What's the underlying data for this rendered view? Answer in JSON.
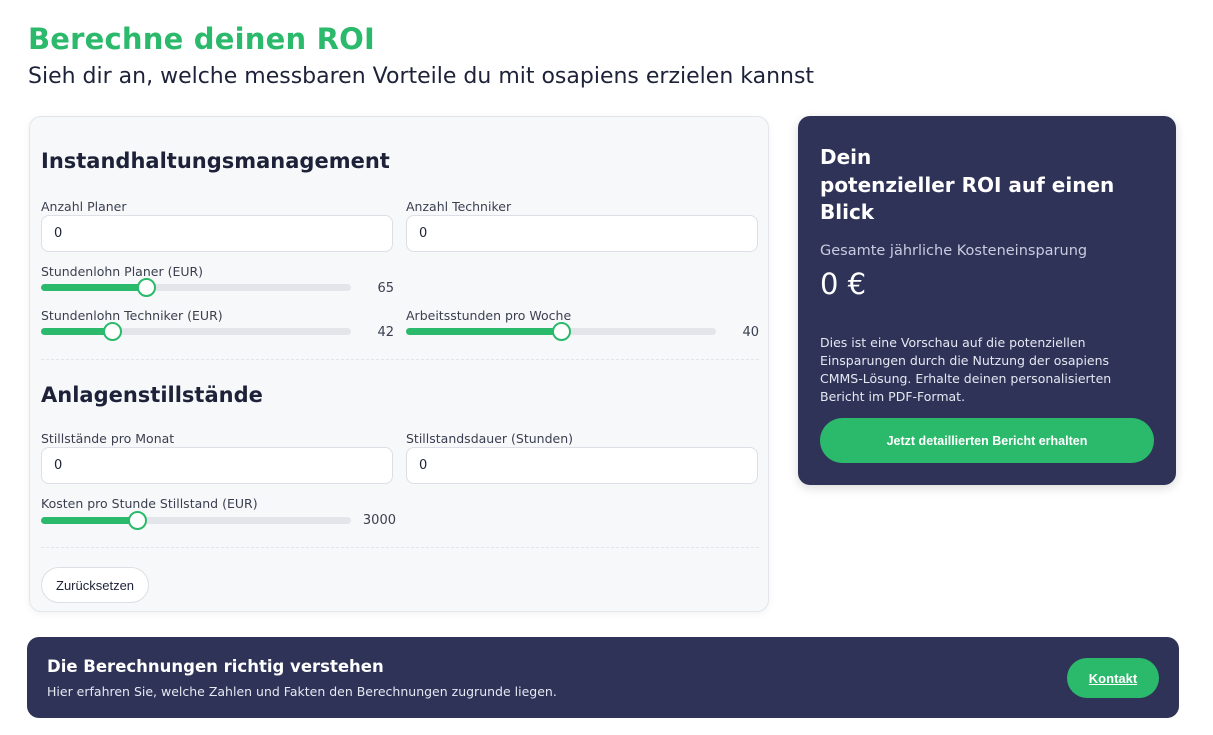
{
  "header": {
    "title": "Berechne deinen ROI",
    "subtitle": "Sieh dir an, welche messbaren Vorteile du mit osapiens erzielen kannst"
  },
  "form": {
    "maintenance": {
      "title": "Instandhaltungsmanagement",
      "planners": {
        "label": "Anzahl Planer",
        "value": "0"
      },
      "technicians": {
        "label": "Anzahl Techniker",
        "value": "0"
      },
      "planner_rate": {
        "label": "Stundenlohn Planer (EUR)",
        "value": "65",
        "fraction": 0.34
      },
      "technician_rate": {
        "label": "Stundenlohn Techniker (EUR)",
        "value": "42",
        "fraction": 0.23
      },
      "hours_per_week": {
        "label": "Arbeitsstunden pro Woche",
        "value": "40",
        "fraction": 0.5
      }
    },
    "downtime": {
      "title": "Anlagenstillstände",
      "per_month": {
        "label": "Stillstände pro Monat",
        "value": "0"
      },
      "duration": {
        "label": "Stillstandsdauer (Stunden)",
        "value": "0"
      },
      "cost_per_hour": {
        "label": "Kosten pro Stunde Stillstand (EUR)",
        "value": "3000",
        "fraction": 0.31
      }
    },
    "reset_label": "Zurücksetzen"
  },
  "roi": {
    "title": "Dein\npotenzieller ROI auf einen Blick",
    "savings_label": "Gesamte jährliche Kosteneinsparung",
    "savings_value": "0 €",
    "description": "Dies ist eine Vorschau auf die potenziellen Einsparungen durch die Nutzung der osapiens CMMS-Lösung. Erhalte deinen personalisierten Bericht im PDF-Format.",
    "cta_label": "Jetzt detaillierten Bericht erhalten"
  },
  "banner": {
    "title": "Die Berechnungen richtig verstehen",
    "subtitle": "Hier erfahren Sie, welche Zahlen und Fakten den Berechnungen zugrunde liegen.",
    "button_label": "Kontakt"
  },
  "colors": {
    "accent": "#2bb96b",
    "navy": "#2e3357"
  }
}
